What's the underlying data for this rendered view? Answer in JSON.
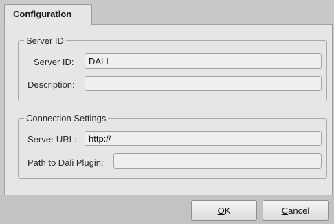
{
  "tabs": [
    {
      "label": "Configuration",
      "active": true
    }
  ],
  "server_id_group": {
    "legend": "Server ID",
    "server_id_label": "Server ID:",
    "server_id_value": "DALI",
    "description_label": "Description:",
    "description_value": ""
  },
  "connection_group": {
    "legend": "Connection Settings",
    "server_url_label": "Server URL:",
    "server_url_value": "http://",
    "plugin_path_label": "Path to Dali Plugin:",
    "plugin_path_value": ""
  },
  "buttons": {
    "ok": {
      "mnemonic": "O",
      "rest": "K"
    },
    "cancel": {
      "mnemonic": "C",
      "rest": "ancel"
    }
  }
}
